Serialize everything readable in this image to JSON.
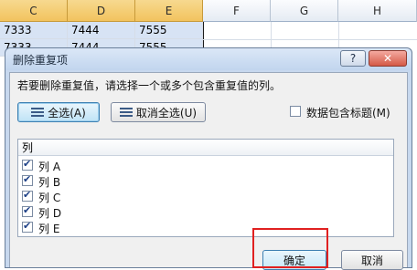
{
  "sheet": {
    "columns": [
      "C",
      "D",
      "E",
      "F",
      "G",
      "H"
    ],
    "selected_columns": [
      "C",
      "D",
      "E"
    ],
    "rows": [
      [
        "7333",
        "7444",
        "7555"
      ],
      [
        "7333",
        "7444",
        "7555"
      ]
    ]
  },
  "dialog": {
    "title": "删除重复项",
    "help_glyph": "?",
    "close_glyph": "✕",
    "instruction": "若要删除重复值，请选择一个或多个包含重复值的列。",
    "select_all": "全选(A)",
    "unselect_all": "取消全选(U)",
    "header_checkbox": {
      "label": "数据包含标题(M)",
      "checked": false
    },
    "list_header": "列",
    "columns": [
      {
        "label": "列 A",
        "checked": true
      },
      {
        "label": "列 B",
        "checked": true
      },
      {
        "label": "列 C",
        "checked": true
      },
      {
        "label": "列 D",
        "checked": true
      },
      {
        "label": "列 E",
        "checked": true
      }
    ],
    "ok": "确定",
    "cancel": "取消"
  },
  "colors": {
    "highlight": "#e02020",
    "title_bar": "#c1d5ee"
  }
}
